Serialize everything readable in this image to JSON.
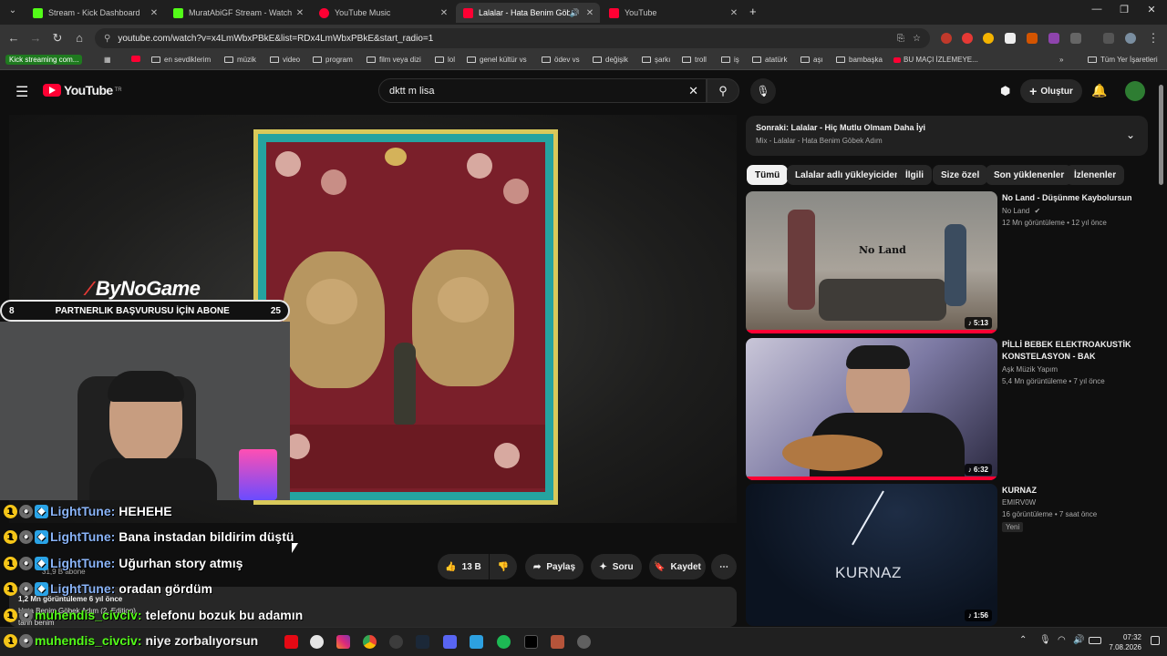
{
  "browser": {
    "tabs": [
      {
        "label": "Stream - Kick Dashboard",
        "color": "#53fc18"
      },
      {
        "label": "MuratAbiGF Stream - Watch Live",
        "color": "#53fc18"
      },
      {
        "label": "YouTube Music",
        "color": "#ff0033"
      },
      {
        "label": "Lalalar - Hata Benim Göbek Adım",
        "color": "#ff0033"
      },
      {
        "label": "YouTube",
        "color": "#ff0033"
      }
    ],
    "new_tab": "+",
    "url": "youtube.com/watch?v=x4LmWbxPBkE&list=RDx4LmWbxPBkE&start_radio=1",
    "bookmarks": [
      "Kick streaming com...",
      "en sevdiklerim",
      "müzik",
      "video",
      "program",
      "film veya dizi",
      "lol",
      "genel kültür vs",
      "ödev vs",
      "değişik",
      "şarkı",
      "troll",
      "iş",
      "atatürk",
      "aşı",
      "bambaşka",
      "BU MAÇI İZLEMEYE...",
      "Tüm Yer İşaretleri"
    ]
  },
  "youtube": {
    "logo": "YouTube",
    "region": "TR",
    "search_value": "dktt  m lisa",
    "create_label": "Oluştur",
    "actions": {
      "like": "13 B",
      "share": "Paylaş",
      "ask": "Soru",
      "save": "Kaydet"
    },
    "partial_text": {
      "subs": "31,9 B abone",
      "views": "1,2 Mn görüntüleme  6 yıl önce",
      "desc": "Hata Benim Göbek Adım (2. Edition)",
      "more": "tarih benim"
    },
    "up_next": {
      "title": "Sonraki: Lalalar - Hiç Mutlu Olmam Daha İyi",
      "subtitle": "Mix - Lalalar - Hata Benim Göbek Adım"
    },
    "chips": [
      "Tümü",
      "Lalalar adlı yükleyiciden",
      "İlgili",
      "Size özel",
      "Son yüklenenler",
      "İzlenenler"
    ],
    "recommendations": [
      {
        "title": "No Land - Düşünme Kaybolursun",
        "channel": "No Land",
        "meta": "12 Mn görüntüleme • 12 yıl önce",
        "duration": "5:13",
        "thumb_text": "No Land"
      },
      {
        "title": "PİLLİ BEBEK ELEKTROAKUSTİK KONSTELASYON - BAK",
        "channel": "Aşk Müzik Yapım",
        "meta": "5,4 Mn görüntüleme • 7 yıl önce",
        "duration": "6:32",
        "thumb_text": ""
      },
      {
        "title": "KURNAZ",
        "channel": "EMIRV0W",
        "meta": "16 görüntüleme • 7 saat önce",
        "duration": "1:56",
        "thumb_text": "KURNAZ",
        "badge": "Yeni"
      }
    ]
  },
  "stream_overlay": {
    "brand": "ByNoGame",
    "partner_left": "8",
    "partner_text": "PARTNERLIK BAŞVURUSU İÇİN ABONE",
    "partner_right": "25",
    "chat": [
      {
        "user": "LightTune:",
        "msg": "HEHEHE",
        "b1": "1"
      },
      {
        "user": "LightTune:",
        "msg": "Bana instadan bildirim düştü",
        "b1": "1"
      },
      {
        "user": "LightTune:",
        "msg": "Uğurhan story atmış",
        "b1": "1"
      },
      {
        "user": "LightTune:",
        "msg": "oradan gördüm",
        "b1": "1"
      },
      {
        "user": "muhendis_civciv:",
        "msg": "telefonu bozuk bu adamın",
        "b1": "1"
      },
      {
        "user": "muhendis_civciv:",
        "msg": "niye zorbalıyorsun",
        "b1": "1"
      }
    ]
  },
  "taskbar": {
    "time": "07:32",
    "date": "7.08.2026"
  }
}
